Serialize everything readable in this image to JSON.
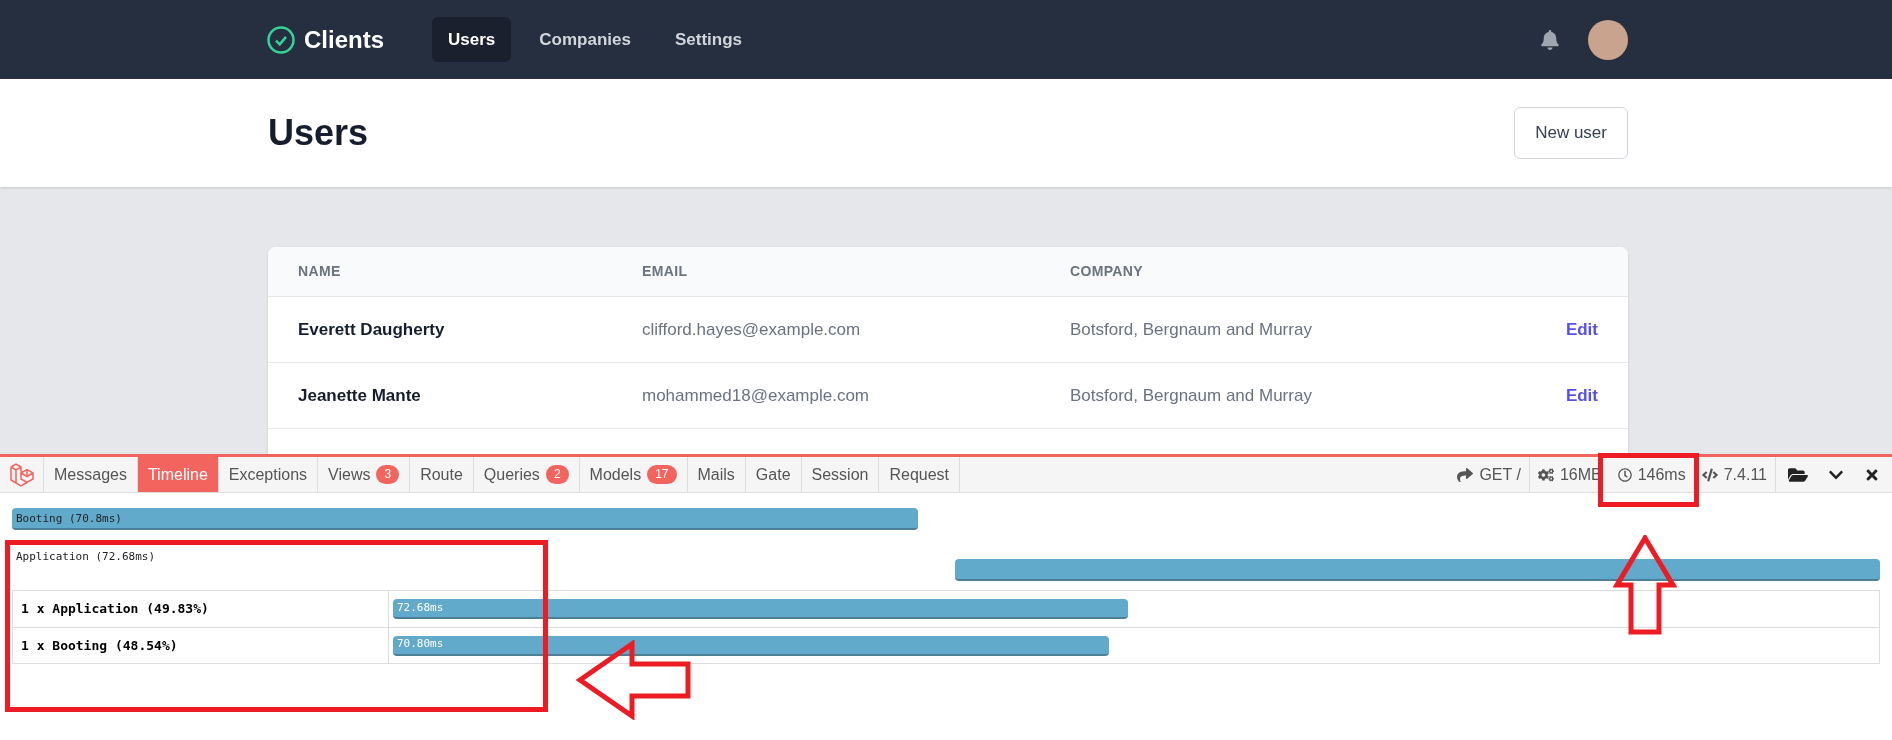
{
  "nav": {
    "brand": "Clients",
    "links": [
      {
        "label": "Users",
        "selected": true
      },
      {
        "label": "Companies",
        "selected": false
      },
      {
        "label": "Settings",
        "selected": false
      }
    ]
  },
  "header": {
    "title": "Users",
    "button": "New user"
  },
  "table": {
    "columns": [
      "NAME",
      "EMAIL",
      "COMPANY"
    ],
    "rows": [
      {
        "name": "Everett Daugherty",
        "email": "clifford.hayes@example.com",
        "company": "Botsford, Bergnaum and Murray",
        "action": "Edit"
      },
      {
        "name": "Jeanette Mante",
        "email": "mohammed18@example.com",
        "company": "Botsford, Bergnaum and Murray",
        "action": "Edit"
      }
    ]
  },
  "debugbar": {
    "tabs": [
      {
        "label": "Messages",
        "selected": false
      },
      {
        "label": "Timeline",
        "selected": true
      },
      {
        "label": "Exceptions",
        "selected": false
      },
      {
        "label": "Views",
        "badge": "3",
        "selected": false
      },
      {
        "label": "Route",
        "selected": false
      },
      {
        "label": "Queries",
        "badge": "2",
        "selected": false
      },
      {
        "label": "Models",
        "badge": "17",
        "selected": false
      },
      {
        "label": "Mails",
        "selected": false
      },
      {
        "label": "Gate",
        "selected": false
      },
      {
        "label": "Session",
        "selected": false
      },
      {
        "label": "Request",
        "selected": false
      }
    ],
    "indicators": [
      {
        "kind": "method",
        "text": "GET /"
      },
      {
        "kind": "memory",
        "text": "16MB"
      },
      {
        "kind": "time",
        "text": "146ms"
      },
      {
        "kind": "version",
        "text": "7.4.11"
      }
    ],
    "timeline": [
      {
        "label": "Booting (70.8ms)",
        "kind": "start"
      },
      {
        "label": "Application (72.68ms)",
        "kind": "end"
      }
    ],
    "measures": [
      {
        "label": "1 x Application (49.83%)",
        "value": "72.68ms"
      },
      {
        "label": "1 x Booting (48.54%)",
        "value": "70.80ms"
      }
    ]
  }
}
